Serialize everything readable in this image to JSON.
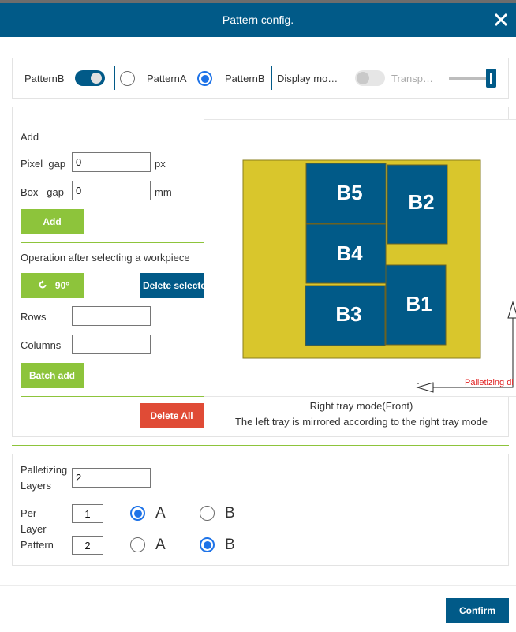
{
  "dialog": {
    "title": "Pattern config.",
    "confirm_label": "Confirm"
  },
  "top_bar": {
    "pattern_toggle_label": "PatternB",
    "radio_a_label": "PatternA",
    "radio_b_label": "PatternB",
    "display_mode_label": "Display mo…",
    "transparency_label": "Transp…",
    "pattern_toggle_on": true,
    "display_mode_on": false,
    "selected_pattern": "PatternB"
  },
  "left_panel": {
    "add_heading": "Add",
    "pixel_gap_label": "Pixel  gap",
    "pixel_gap_value": "0",
    "pixel_unit": "px",
    "box_gap_label": "Box   gap",
    "box_gap_value": "0",
    "box_unit": "mm",
    "add_button": "Add",
    "operation_heading": "Operation after selecting a workpiece",
    "rotate_button": "90°",
    "delete_selected_button": "Delete selecte",
    "rows_label": "Rows",
    "rows_value": "",
    "columns_label": "Columns",
    "columns_value": "",
    "batch_add_button": "Batch add",
    "delete_all_button": "Delete All"
  },
  "preview": {
    "boxes": [
      "B5",
      "B2",
      "B4",
      "B3",
      "B1"
    ],
    "palletizing_direction_label": "Palletizing di",
    "tray_mode_line1": "Right tray mode(Front)",
    "tray_mode_line2": "The left tray is mirrored according to the right tray mode",
    "tray_color": "#d9c62c",
    "box_color": "#015a88"
  },
  "layers": {
    "palletizing_layers_label": "Palletizing Layers",
    "palletizing_layers_value": "2",
    "per_layer_pattern_label": "Per Layer Pattern",
    "rows": [
      {
        "layer": "1",
        "selected": "A"
      },
      {
        "layer": "2",
        "selected": "B"
      }
    ],
    "option_a": "A",
    "option_b": "B"
  }
}
